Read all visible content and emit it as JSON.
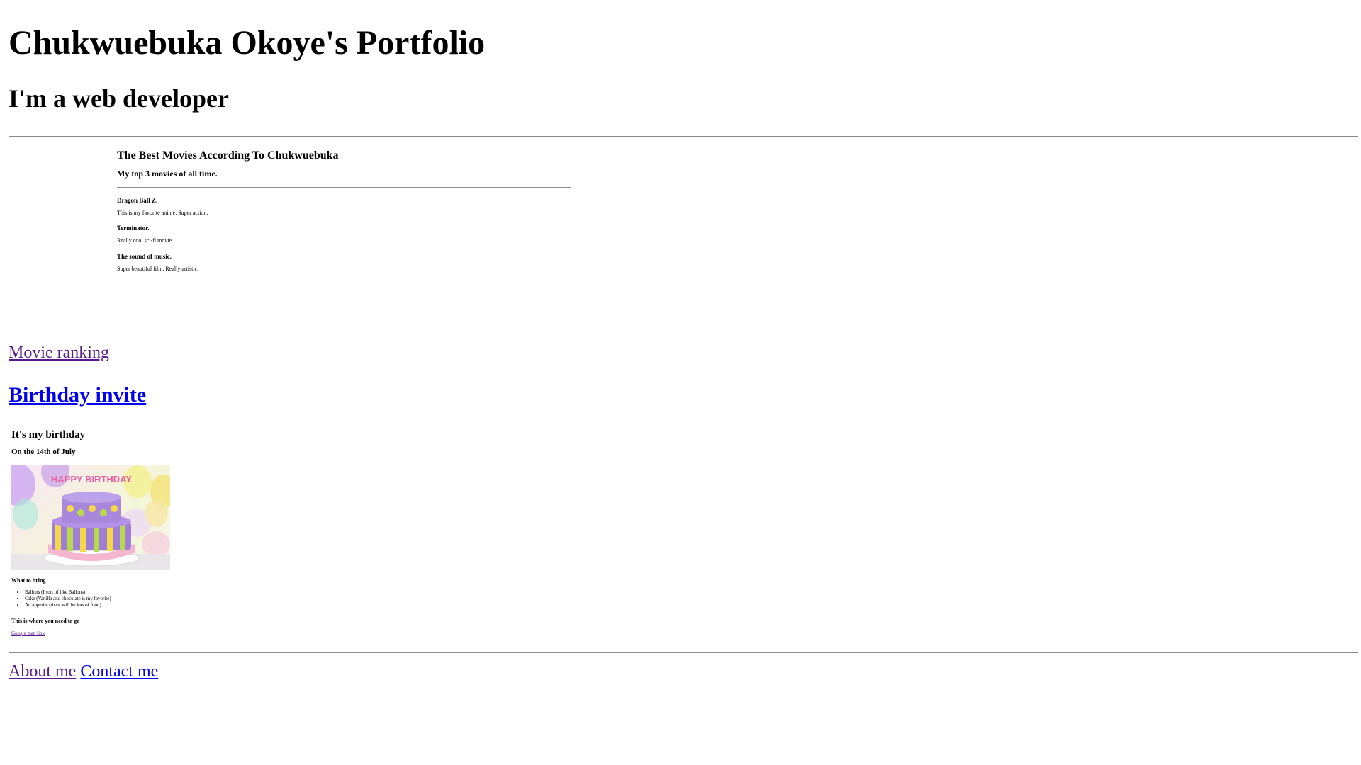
{
  "header": {
    "title": "Chukwuebuka Okoye's Portfolio",
    "subtitle": "I'm a web developer"
  },
  "movies": {
    "title": "The Best Movies According To Chukwuebuka",
    "subtitle": "My top 3 movies of all time.",
    "items": [
      {
        "title": "Dragon Ball Z.",
        "description": "This is my favorite anime. Super action."
      },
      {
        "title": "Terminator.",
        "description": "Really cool sci-fi movie."
      },
      {
        "title": "The sound of music.",
        "description": "Super beautiful film. Really artistic."
      }
    ],
    "link_label": "Movie ranking"
  },
  "birthday": {
    "link_label": "Birthday invite",
    "title": "It's my birthday",
    "date": "On the 14th of July",
    "image_text": "HAPPY BIRTHDAY",
    "bring_heading": "What to bring",
    "bring_items": [
      "Ballons (I sort of like Ballons)",
      "Cake (Vanilla and chocolate is my favorite)",
      "An appetite (there will be lots of food)"
    ],
    "where_heading": "This is where you need to go",
    "map_link": "Google map link"
  },
  "footer": {
    "about_label": "About me",
    "contact_label": "Contact me"
  },
  "colors": {
    "visited_link": "#551a8b",
    "unvisited_link": "#0000ee",
    "rule": "#8a8a8a"
  }
}
